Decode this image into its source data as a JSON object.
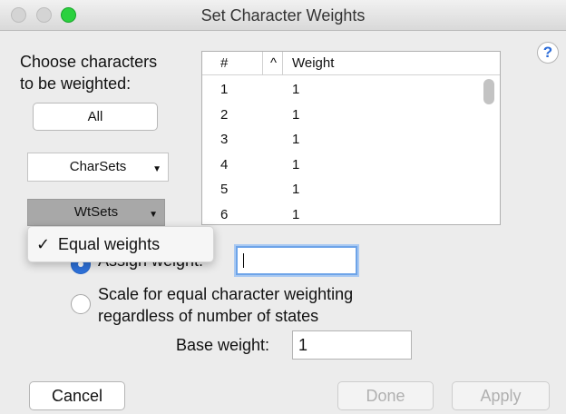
{
  "window": {
    "title": "Set Character Weights",
    "help_label": "?"
  },
  "left_panel": {
    "choose_label_line1": "Choose characters",
    "choose_label_line2": "to be weighted:",
    "all_button": "All",
    "charsets_label": "CharSets",
    "wtsets_label": "WtSets",
    "dropdown_arrow": "▼"
  },
  "table": {
    "headers": {
      "num": "#",
      "sort": "^",
      "weight": "Weight"
    },
    "rows": [
      {
        "num": "1",
        "weight": "1"
      },
      {
        "num": "2",
        "weight": "1"
      },
      {
        "num": "3",
        "weight": "1"
      },
      {
        "num": "4",
        "weight": "1"
      },
      {
        "num": "5",
        "weight": "1"
      },
      {
        "num": "6",
        "weight": "1"
      }
    ]
  },
  "wtsets_menu": {
    "check": "✓",
    "item": "Equal weights"
  },
  "options": {
    "assign_label": "Assign weight:",
    "assign_value": "",
    "scale_line1": "Scale for equal character weighting",
    "scale_line2": "regardless of number of states",
    "selected": "assign"
  },
  "base": {
    "label": "Base weight:",
    "value": "1"
  },
  "footer": {
    "cancel": "Cancel",
    "done": "Done",
    "apply": "Apply"
  },
  "colors": {
    "accent": "#2e71d9",
    "zoom_button": "#2bd13f",
    "popup_selected": "#a8a8a8"
  }
}
